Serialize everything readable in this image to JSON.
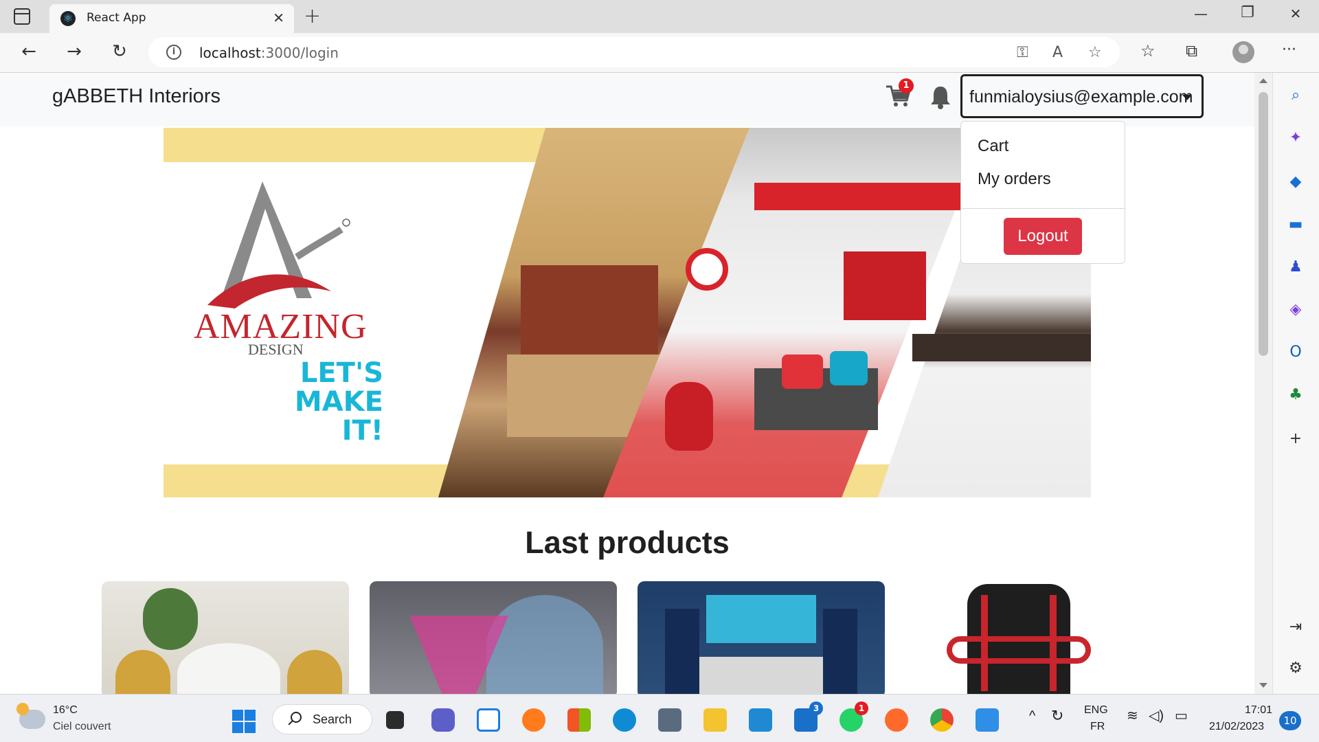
{
  "browser": {
    "tab_title": "React App",
    "url_host": "localhost",
    "url_path": ":3000/login"
  },
  "site": {
    "brand": "gABBETH Interiors",
    "cart_count": "1",
    "user_email": "funmialoysius@example.com",
    "dropdown": {
      "items": [
        {
          "label": "Cart"
        },
        {
          "label": "My orders"
        }
      ],
      "logout_label": "Logout"
    },
    "hero": {
      "brand_word": "AMAZING",
      "brand_sub": "DESIGN",
      "slogan_line1": "LET'S",
      "slogan_line2": "MAKE",
      "slogan_line3": "IT!"
    },
    "section_title": "Last products"
  },
  "taskbar": {
    "weather_temp": "16°C",
    "weather_cond": "Ciel couvert",
    "search_label": "Search",
    "mail_badge": "3",
    "whatsapp_badge": "1",
    "lang_top": "ENG",
    "lang_bottom": "FR",
    "time": "17:01",
    "date": "21/02/2023",
    "notifications": "10"
  },
  "colors": {
    "accent_red": "#dc3545",
    "badge_red": "#e31b23",
    "hero_yellow": "#f5df8e",
    "slogan_cyan": "#19b6d8"
  }
}
